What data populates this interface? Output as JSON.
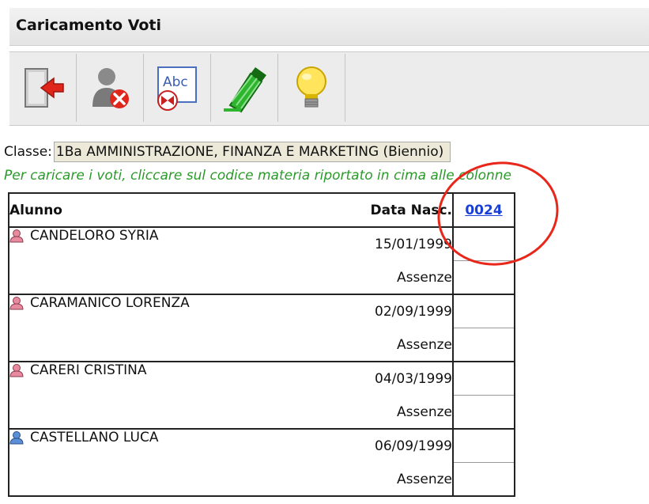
{
  "title": "Caricamento Voti",
  "toolbar": {
    "buttons": [
      {
        "icon": "exit-door-icon"
      },
      {
        "icon": "user-delete-icon"
      },
      {
        "icon": "spellcheck-icon"
      },
      {
        "icon": "highlighter-icon"
      },
      {
        "icon": "lightbulb-icon"
      }
    ]
  },
  "classe": {
    "label": "Classe:",
    "value": "1Ba AMMINISTRAZIONE, FINANZA E MARKETING (Biennio)"
  },
  "hint": "Per caricare i voti, cliccare sul codice materia riportato in cima alle colonne",
  "table": {
    "headers": {
      "alunno": "Alunno",
      "data": "Data Nasc.",
      "code": "0024"
    },
    "rows": [
      {
        "name": "CANDELORO SYRIA",
        "date": "15/01/1999",
        "absence_label": "Assenze",
        "gender": "female"
      },
      {
        "name": "CARAMANICO LORENZA",
        "date": "02/09/1999",
        "absence_label": "Assenze",
        "gender": "female"
      },
      {
        "name": "CARERI CRISTINA",
        "date": "04/03/1999",
        "absence_label": "Assenze",
        "gender": "female"
      },
      {
        "name": "CASTELLANO LUCA",
        "date": "06/09/1999",
        "absence_label": "Assenze",
        "gender": "male"
      }
    ]
  },
  "colors": {
    "hint_text": "#2a9a2a",
    "link": "#1a3fd6",
    "annotation_circle": "#e8261a",
    "female_icon": "#e88aa0",
    "male_icon": "#5b8fd6"
  }
}
